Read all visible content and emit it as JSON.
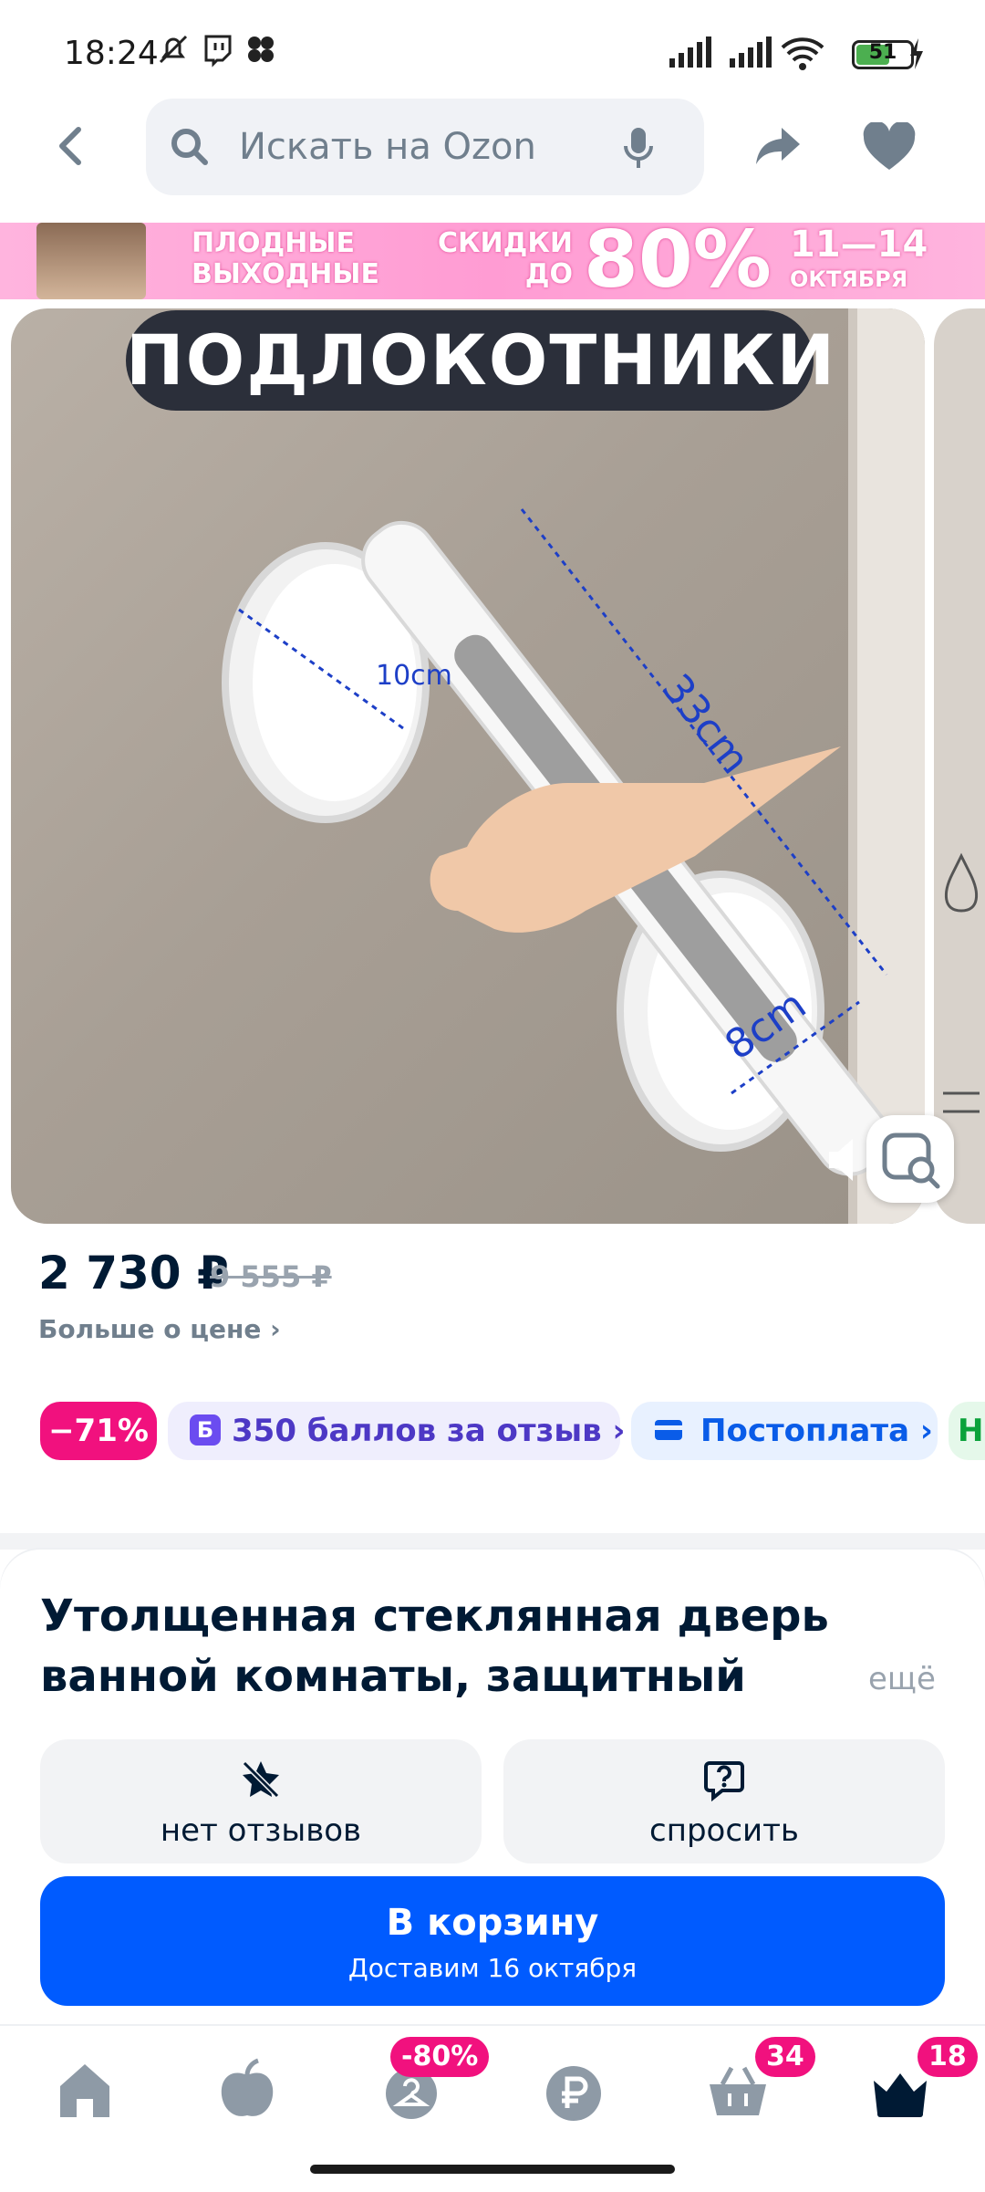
{
  "status_bar": {
    "time": "18:24",
    "battery": "51"
  },
  "search": {
    "placeholder": "Искать на Ozon"
  },
  "banner": {
    "line1": "ПЛОДНЫЕ",
    "line2": "ВЫХОДНЫЕ",
    "line3": "СКИДКИ",
    "line4": "ДО",
    "line5": "80%",
    "line6": "11—14",
    "line7": "ОКТЯБРЯ"
  },
  "product_image": {
    "label": "ПОДЛОКОТНИКИ",
    "dim1": "10cm",
    "dim2": "33cm",
    "dim3": "8cm"
  },
  "price": {
    "current": "2 730 ₽",
    "old": "9 555 ₽",
    "more": "Больше о цене ›"
  },
  "chips": {
    "discount": "−71%",
    "bonus_icon": "Б",
    "bonus": "350 баллов за отзыв ›",
    "postpay": "Постоплата ›",
    "next": "Н"
  },
  "title": "Утолщенная стеклянная дверь ванной комнаты, защитный",
  "more": "ещё",
  "actions": {
    "reviews": "нет отзывов",
    "ask": "спросить"
  },
  "cart": {
    "label": "В корзину",
    "delivery": "Доставим 16 октября"
  },
  "bottom_nav": {
    "badge_fresh": "-80%",
    "badge_cart": "34",
    "badge_profile": "18"
  },
  "colors": {
    "accent": "#005bff",
    "badge": "#f1117e"
  },
  "icons": [
    "back-icon",
    "search-icon",
    "mic-icon",
    "share-icon",
    "heart-icon",
    "visual-search-icon",
    "sound-icon",
    "star-off-icon",
    "question-icon",
    "home-icon",
    "fresh-icon",
    "hanger-icon",
    "ruble-icon",
    "cart-icon",
    "crown-icon"
  ]
}
